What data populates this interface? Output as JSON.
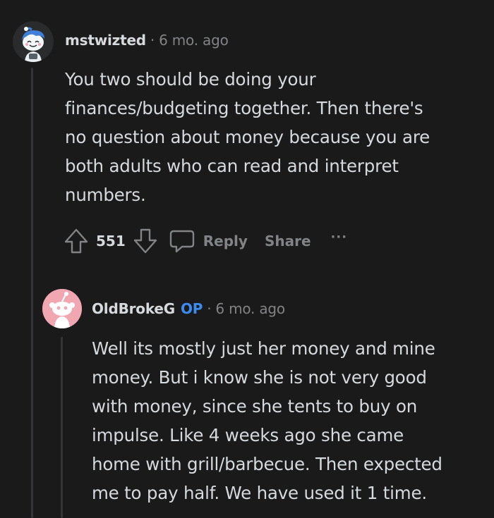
{
  "comments": [
    {
      "username": "mstwizted",
      "separator": "·",
      "time": "6 mo. ago",
      "body_lines": [
        "You two should be doing your",
        "finances/budgeting together. Then there's",
        "no question about money because you are",
        "both adults who can read and interpret",
        "numbers."
      ],
      "score": "551",
      "reply_label": "Reply",
      "share_label": "Share",
      "more_label": "···"
    },
    {
      "username": "OldBrokeG",
      "op_badge": "OP",
      "separator": "·",
      "time": "6 mo. ago",
      "body_lines": [
        "Well its mostly just her money and mine",
        "money. But i know she is not very good",
        "with money, since she tents to buy on",
        "impulse. Like 4 weeks ago she came",
        "home with grill/barbecue. Then expected",
        "me to pay half. We have used it 1 time."
      ]
    }
  ],
  "colors": {
    "background": "#1a1a1b",
    "text": "#d7dadc",
    "muted": "#818384",
    "op": "#3c8cf0",
    "thread_line": "#343536",
    "avatar_pink": "#f1a7b2"
  }
}
